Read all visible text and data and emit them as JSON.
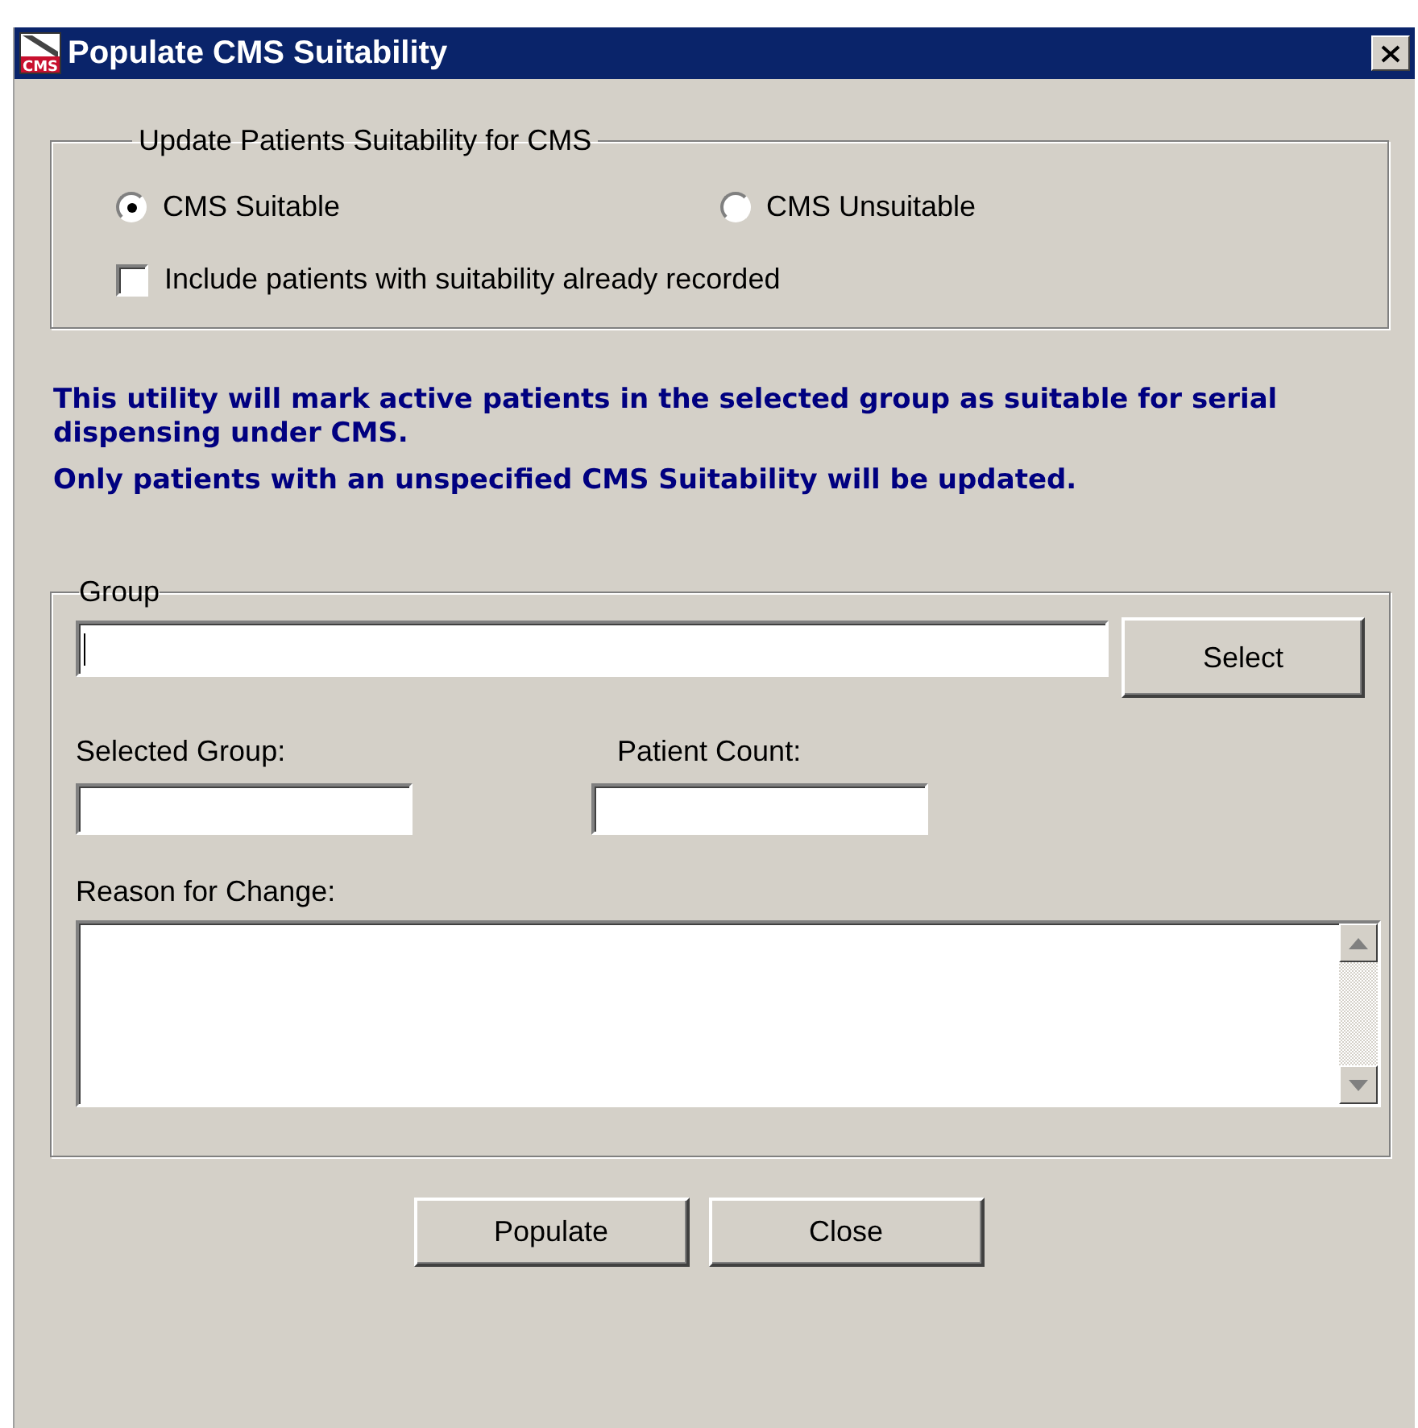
{
  "window": {
    "title": "Populate CMS Suitability",
    "icon_label": "CMS"
  },
  "suitability": {
    "legend": "Update Patients Suitability for CMS",
    "options": [
      {
        "label": "CMS Suitable",
        "selected": true
      },
      {
        "label": "CMS Unsuitable",
        "selected": false
      }
    ],
    "include_recorded": {
      "label": "Include patients with suitability already recorded",
      "checked": false
    }
  },
  "info": [
    "This utility will mark active patients in the selected group as suitable for serial dispensing under CMS.",
    "Only patients with an unspecified CMS Suitability will be updated."
  ],
  "group": {
    "legend": "Group",
    "select_button": "Select",
    "selected_group_label": "Selected Group:",
    "patient_count_label": "Patient Count:",
    "reason_label": "Reason for Change:"
  },
  "buttons": [
    "Populate",
    "Close"
  ]
}
